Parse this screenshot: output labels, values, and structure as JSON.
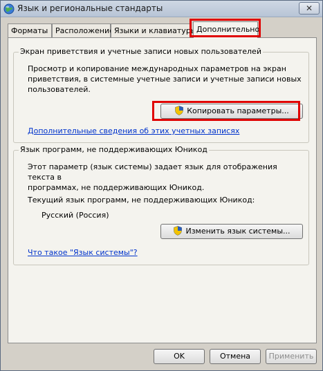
{
  "window": {
    "title": "Язык и региональные стандарты",
    "close_label": "✕"
  },
  "tabs": [
    {
      "label": "Форматы"
    },
    {
      "label": "Расположение"
    },
    {
      "label": "Языки и клавиатуры"
    },
    {
      "label": "Дополнительно",
      "active": true
    }
  ],
  "welcome_group": {
    "legend": "Экран приветствия и учетные записи новых пользователей",
    "line1": "Просмотр и копирование международных параметров на экран",
    "line2": "приветствия, в системные учетные записи и учетные записи новых",
    "line3": "пользователей.",
    "copy_button": "Копировать параметры...",
    "more_link": "Дополнительные сведения об этих учетных записях"
  },
  "nonunicode_group": {
    "legend": "Язык программ, не поддерживающих Юникод",
    "line1": "Этот параметр (язык системы) задает язык для отображения текста в",
    "line2": "программах, не поддерживающих Юникод.",
    "current_label": "Текущий язык программ, не поддерживающих Юникод:",
    "current_value": "Русский (Россия)",
    "change_button": "Изменить язык системы...",
    "what_link": "Что такое \"Язык системы\"?"
  },
  "buttons": {
    "ok": "OK",
    "cancel": "Отмена",
    "apply": "Применить"
  },
  "icons": {
    "globe": "globe-icon",
    "shield": "uac-shield-icon"
  },
  "colors": {
    "highlight": "#e00000",
    "link": "#0033cc"
  }
}
